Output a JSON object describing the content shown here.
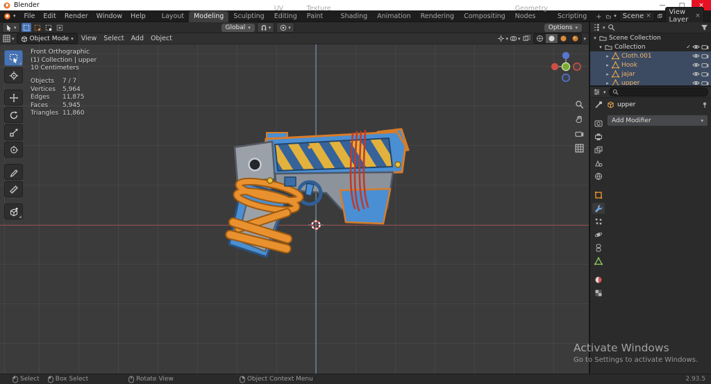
{
  "glyphs": {
    "chevron": "▾",
    "twisty_open": "▾",
    "twisty_closed": "▸",
    "plus": "+",
    "minimize": "—",
    "maximize": "□",
    "close": "×",
    "x_small": "×",
    "check": "✓"
  },
  "titlebar": {
    "app": "Blender"
  },
  "menubar": {
    "menus": [
      "File",
      "Edit",
      "Render",
      "Window",
      "Help"
    ],
    "tabs": [
      "Layout",
      "Modeling",
      "Sculpting",
      "UV Editing",
      "Texture Paint",
      "Shading",
      "Animation",
      "Rendering",
      "Compositing",
      "Geometry Nodes",
      "Scripting"
    ],
    "scene_label": "Scene",
    "view_layer_label": "View Layer"
  },
  "toolbar": {
    "orientation": "Global",
    "options": "Options"
  },
  "viewport": {
    "mode": "Object Mode",
    "menus": [
      "View",
      "Select",
      "Add",
      "Object"
    ],
    "overlay": {
      "view": "Front Orthographic",
      "context": "(1) Collection | upper",
      "units": "10 Centimeters"
    },
    "stats": {
      "labels": [
        "Objects",
        "Vertices",
        "Edges",
        "Faces",
        "Triangles"
      ],
      "values": [
        "7 / 7",
        "5,964",
        "11,875",
        "5,945",
        "11,860"
      ]
    }
  },
  "outliner": {
    "root": "Scene Collection",
    "collection": "Collection",
    "objects": [
      "Cloth.001",
      "Hook",
      "jajar",
      "upper"
    ]
  },
  "properties": {
    "search_placeholder": "",
    "active_object": "upper",
    "add_modifier": "Add Modifier"
  },
  "statusbar": {
    "hints": [
      "Select",
      "Box Select",
      "Rotate View",
      "Object Context Menu"
    ],
    "version": "2.93.5"
  },
  "watermark": {
    "line1": "Activate Windows",
    "line2": "Go to Settings to activate Windows."
  },
  "colors": {
    "accent": "#4772b3",
    "object_orange": "#e8912e",
    "selected_text": "#eeb36a"
  }
}
